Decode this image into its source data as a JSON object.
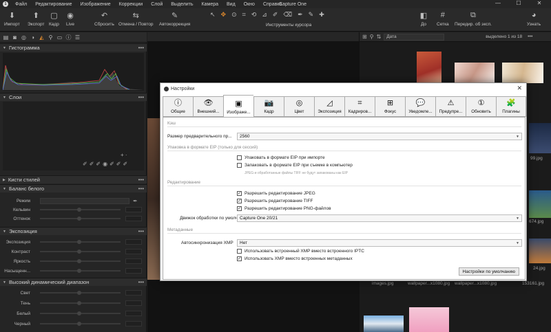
{
  "app": {
    "title": "Capture One",
    "menu": [
      "Файл",
      "Редактирование",
      "Изображение",
      "Коррекции",
      "Слой",
      "Выделить",
      "Камера",
      "Вид",
      "Окно",
      "Справка"
    ],
    "window_controls": [
      "—",
      "☐",
      "✕"
    ]
  },
  "toolbar": {
    "import": "Импорт",
    "export": "Экспорт",
    "frame": "Кадр",
    "live": "Live",
    "reset": "Сбросить",
    "undo_redo": "Отмена / Повтор",
    "autocorrect": "Автокоррекция",
    "cursor_tools": "Инструменты курсора",
    "before": "До",
    "grid": "Сетка",
    "export_recipes": "Передир. об эксп.",
    "learn": "Узнать"
  },
  "left_panel": {
    "histogram_title": "Гистограмма",
    "layers_title": "Слои",
    "brushes_title": "Кисти стилей",
    "wb_title": "Баланс белого",
    "wb_rows": [
      "Режим",
      "Кельвин",
      "Оттенок"
    ],
    "exposure_title": "Экспозиция",
    "exposure_rows": [
      "Экспозиция",
      "Контраст",
      "Яркость",
      "Насыщенн..."
    ],
    "hdr_title": "Высокий динамический диапазон",
    "hdr_rows": [
      "Свет",
      "Тень",
      "Белый",
      "Черный"
    ]
  },
  "browser": {
    "sort": "Дата",
    "selected": "выделено 1 из 18",
    "captions": [
      "images.jpg",
      "wallpaper...x1080.jpg",
      "wallpaper...x1080.jpg",
      "153161.jpg"
    ],
    "side_labels": [
      "99.jpg",
      "674.jpg",
      "24.jpg"
    ]
  },
  "dialog": {
    "title": "Настройки",
    "close": "✕",
    "tabs": [
      {
        "icon": "ⓘ",
        "label": "Общие"
      },
      {
        "icon": "👁",
        "label": "Внешний..."
      },
      {
        "icon": "▣",
        "label": "Изображе..."
      },
      {
        "icon": "📷",
        "label": "Кадр"
      },
      {
        "icon": "◎",
        "label": "Цвет"
      },
      {
        "icon": "◿",
        "label": "Экспозиция"
      },
      {
        "icon": "⌗",
        "label": "Кадриров..."
      },
      {
        "icon": "⊞",
        "label": "Фокус"
      },
      {
        "icon": "💬",
        "label": "Уведомле..."
      },
      {
        "icon": "⚠",
        "label": "Предупре..."
      },
      {
        "icon": "①",
        "label": "Обновить"
      },
      {
        "icon": "🧩",
        "label": "Плагины"
      }
    ],
    "active_tab": 2,
    "cache_section": "Кэш",
    "preview_size_label": "Размер предварительного пр...",
    "preview_size_value": "2560",
    "eip_section": "Упаковка в формате EIP (только для сессий)",
    "eip_import": "Упаковать в формате EIP при импорте",
    "eip_capture": "Запаковать в формате EIP при съемке в компьютер",
    "eip_note": "JPEG-и обработанные файлы TIFF не будут запакованы как EIP",
    "edit_section": "Редактирование",
    "allow_jpeg": "Разрешить редактирование JPEG",
    "allow_tiff": "Разрешить редактирование TIFF",
    "allow_png": "Разрешить редактирование PNG-файлов",
    "engine_label": "Движок обработки по умолч...",
    "engine_value": "Capture One 20/21",
    "meta_section": "Метаданные",
    "xmp_label": "Автосинхронизация XMP",
    "xmp_value": "Нет",
    "use_embedded_xmp": "Использовать встроенный XMP вместо встроенного IPTC",
    "use_xmp_meta": "Использовать XMP вместо встроенных метаданных",
    "defaults_button": "Настройки по умолчанию",
    "checks": {
      "eip_import": false,
      "eip_capture": false,
      "allow_jpeg": true,
      "allow_tiff": true,
      "allow_png": true,
      "use_embedded_xmp": false,
      "use_xmp_meta": true
    }
  }
}
